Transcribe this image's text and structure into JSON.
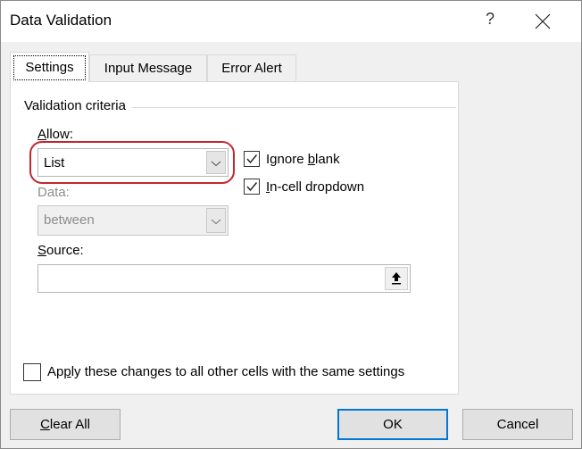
{
  "dialog": {
    "title": "Data Validation",
    "help_label": "?",
    "close_icon": "close-icon"
  },
  "tabs": [
    {
      "label": "Settings",
      "active": true
    },
    {
      "label": "Input Message",
      "active": false
    },
    {
      "label": "Error Alert",
      "active": false
    }
  ],
  "settings": {
    "group_label": "Validation criteria",
    "allow": {
      "label_accel": "A",
      "label_rest": "llow:",
      "value": "List",
      "highlighted": true,
      "highlight_color": "#c4262e"
    },
    "ignore_blank": {
      "label_pre": "Ignore ",
      "label_accel": "b",
      "label_post": "lank",
      "checked": true
    },
    "in_cell_dropdown": {
      "label_accel": "I",
      "label_rest": "n-cell dropdown",
      "checked": true
    },
    "data": {
      "label": "Data:",
      "value": "between",
      "disabled": true
    },
    "source": {
      "label_accel": "S",
      "label_rest": "ource:",
      "value": "",
      "refedit_icon": "collapse-dialog-icon"
    },
    "apply_all": {
      "label_pre": "Ap",
      "label_accel": "p",
      "label_post": "ly these changes to all other cells with the same settings",
      "checked": false
    }
  },
  "buttons": {
    "clear_all_accel": "C",
    "clear_all_rest": "lear All",
    "ok": "OK",
    "cancel": "Cancel"
  },
  "colors": {
    "accent": "#0078d7",
    "highlight": "#c4262e"
  }
}
